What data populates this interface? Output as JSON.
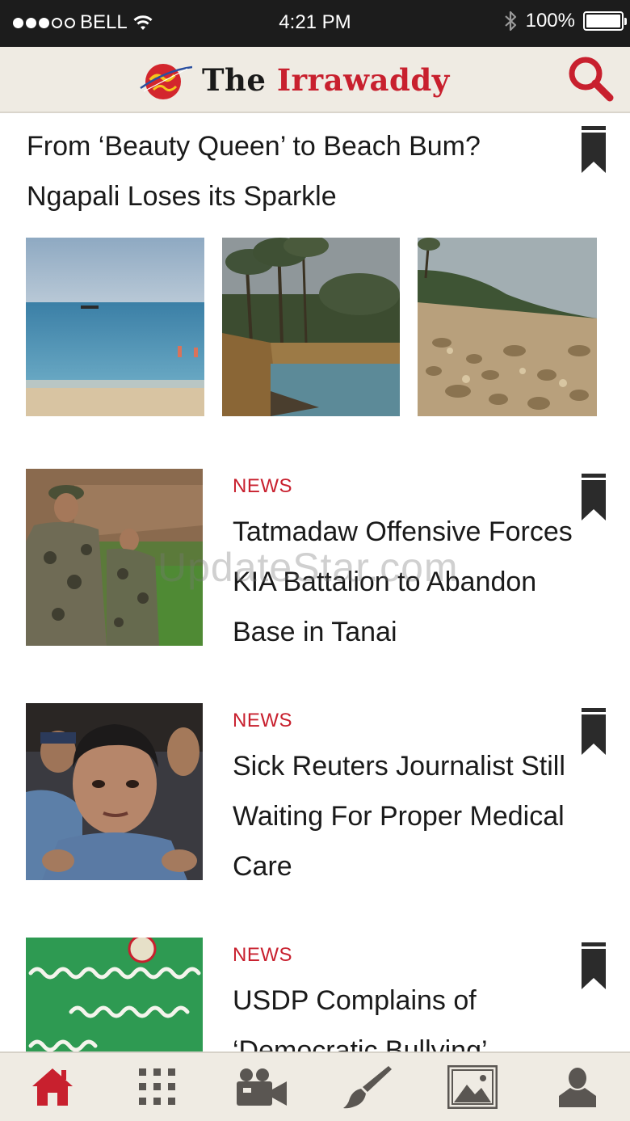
{
  "status_bar": {
    "carrier": "BELL",
    "time": "4:21 PM",
    "battery": "100%",
    "signal_bars_filled": 3,
    "signal_bars_total": 5,
    "icons": [
      "wifi-icon",
      "bluetooth-icon",
      "battery-icon"
    ]
  },
  "header": {
    "logo_the": "The",
    "logo_name": "Irrawaddy",
    "search_icon": "search-icon"
  },
  "featured": {
    "title": "From ‘Beauty Queen’ to Beach Bum? Ngapali Loses its Sparkle",
    "images": [
      "beach-sea-photo",
      "palm-shore-photo",
      "rocky-beach-photo"
    ]
  },
  "articles": [
    {
      "category": "NEWS",
      "title": "Tatmadaw Offensive Forces KIA Battalion to Abandon Base in Tanai",
      "image": "soldiers-photo"
    },
    {
      "category": "NEWS",
      "title": "Sick Reuters Journalist Still Waiting For Proper Medical Care",
      "image": "journalist-photo"
    },
    {
      "category": "NEWS",
      "title": "USDP Complains of ‘Democratic Bullying’",
      "image": "green-banner-photo"
    }
  ],
  "watermark": "UpdateStar.com",
  "tabbar": {
    "items": [
      "home",
      "sections",
      "video",
      "opinion",
      "photo",
      "profile"
    ],
    "active": "home"
  },
  "colors": {
    "accent": "#c8202e",
    "header_bg": "#efebe3",
    "tab_icon": "#5a5652",
    "status_bg": "#1c1c1c"
  }
}
